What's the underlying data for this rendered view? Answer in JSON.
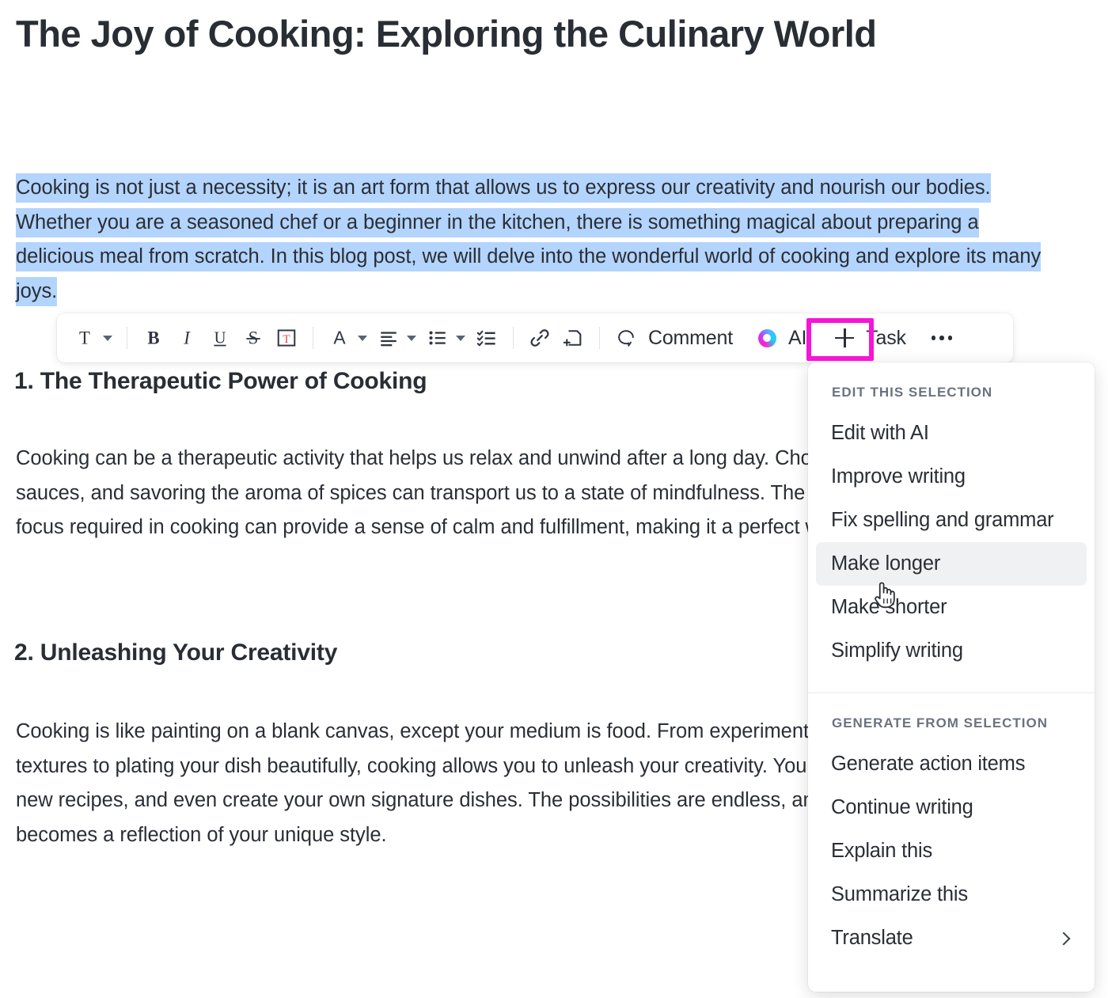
{
  "document": {
    "title": "The Joy of Cooking: Exploring the Culinary World",
    "selected_paragraph": "Cooking is not just a necessity; it is an art form that allows us to express our creativity and nourish our bodies. Whether you are a seasoned chef or a beginner in the kitchen, there is something magical about preparing a delicious meal from scratch. In this blog post, we will delve into the wonderful world of cooking and explore its many joys.",
    "sections": [
      {
        "heading": "1. The Therapeutic Power of Cooking",
        "body": "Cooking can be a therapeutic activity that helps us relax and unwind after a long day. Chopping vegetables, stirring sauces, and savoring the aroma of spices can transport us to a state of mindfulness. The rhythmic motions and focus required in cooking can provide a sense of calm and fulfillment, making it a perfect way to de-stress."
      },
      {
        "heading": "2. Unleashing Your Creativity",
        "body": "Cooking is like painting on a blank canvas, except your medium is food. From experimenting with different flavors and textures to plating your dish beautifully, cooking allows you to unleash your creativity. You can play with ingredients, try new recipes, and even create your own signature dishes. The possibilities are endless, and each culinary creation becomes a reflection of your unique style."
      }
    ]
  },
  "toolbar": {
    "text_style_icon": "text-style-icon",
    "bold_label": "B",
    "italic_label": "I",
    "underline_label": "U",
    "strikethrough_label": "S",
    "highlight_label": "T",
    "font_color_label": "A",
    "align_icon": "align-left-icon",
    "bullet_list_icon": "bullet-list-icon",
    "checklist_icon": "checklist-icon",
    "link_icon": "link-icon",
    "attach_icon": "add-page-icon",
    "comment_label": "Comment",
    "ai_label": "AI",
    "task_label": "Task",
    "more_label": "more-options"
  },
  "ai_menu": {
    "sections": [
      {
        "header": "EDIT THIS SELECTION",
        "items": [
          {
            "label": "Edit with AI",
            "active": false,
            "submenu": false
          },
          {
            "label": "Improve writing",
            "active": false,
            "submenu": false
          },
          {
            "label": "Fix spelling and grammar",
            "active": false,
            "submenu": false
          },
          {
            "label": "Make longer",
            "active": true,
            "submenu": false
          },
          {
            "label": "Make shorter",
            "active": false,
            "submenu": false
          },
          {
            "label": "Simplify writing",
            "active": false,
            "submenu": false
          }
        ]
      },
      {
        "header": "GENERATE FROM SELECTION",
        "items": [
          {
            "label": "Generate action items",
            "active": false,
            "submenu": false
          },
          {
            "label": "Continue writing",
            "active": false,
            "submenu": false
          },
          {
            "label": "Explain this",
            "active": false,
            "submenu": false
          },
          {
            "label": "Summarize this",
            "active": false,
            "submenu": false
          },
          {
            "label": "Translate",
            "active": false,
            "submenu": true
          }
        ]
      }
    ]
  },
  "colors": {
    "selection_highlight": "#b3d4fd",
    "annotation_box": "#f714d6",
    "menu_active_row": "#eff1f3",
    "text_primary": "#2a2e35",
    "menu_header": "#6b7280",
    "highlight_icon_red": "#e8464a"
  }
}
